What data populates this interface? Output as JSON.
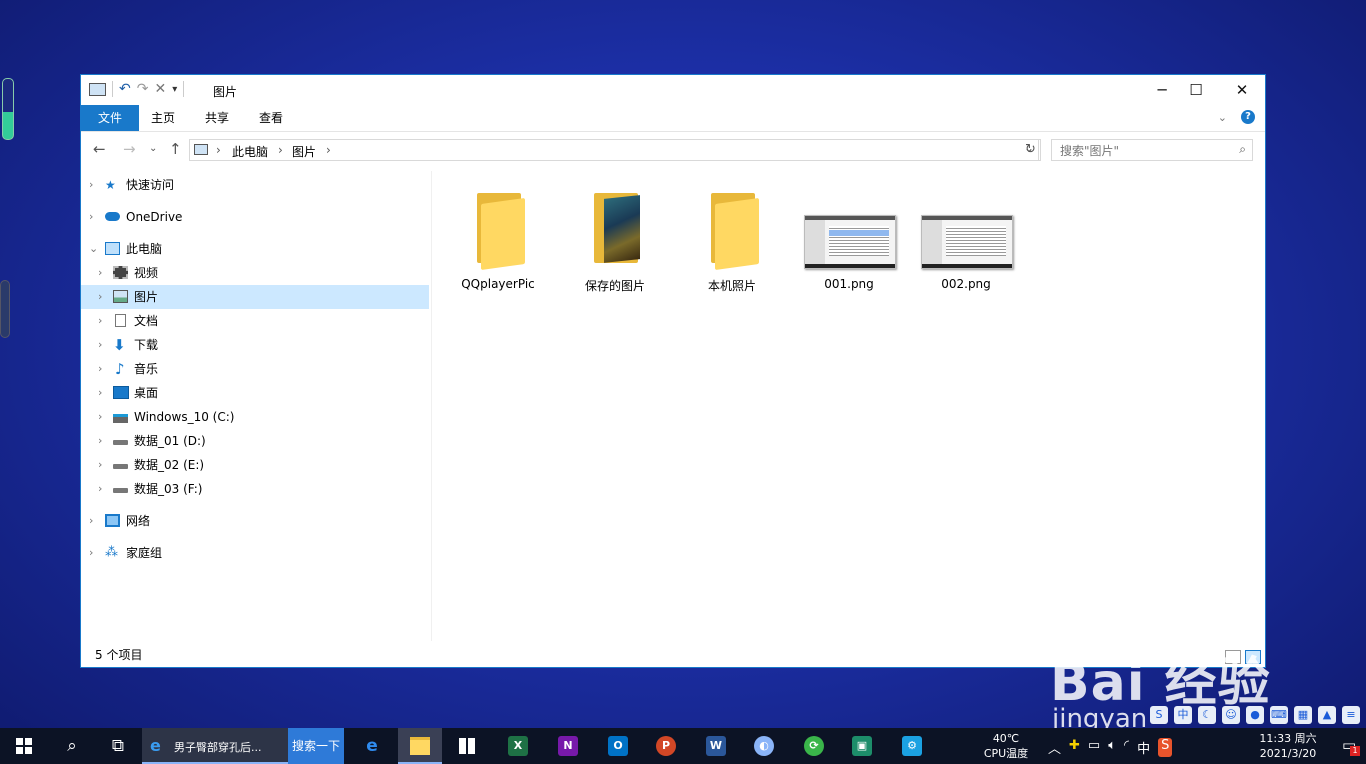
{
  "window": {
    "title": "图片",
    "controls": {
      "minimize": "─",
      "maximize": "☐",
      "close": "✕"
    }
  },
  "ribbon": {
    "tabs": [
      "文件",
      "主页",
      "共享",
      "查看"
    ],
    "expand_icon": "chevron-down-icon",
    "help": "?"
  },
  "address": {
    "crumbs": [
      "此电脑",
      "图片"
    ],
    "sep": "›",
    "search_placeholder": "搜索\"图片\""
  },
  "nav": {
    "items": [
      {
        "label": "快速访问",
        "icon": "star-icon"
      },
      {
        "label": "OneDrive",
        "icon": "cloud-icon"
      },
      {
        "label": "此电脑",
        "icon": "computer-icon"
      },
      {
        "label": "视频",
        "icon": "video-icon"
      },
      {
        "label": "图片",
        "icon": "pictures-icon"
      },
      {
        "label": "文档",
        "icon": "documents-icon"
      },
      {
        "label": "下载",
        "icon": "download-icon"
      },
      {
        "label": "音乐",
        "icon": "music-icon"
      },
      {
        "label": "桌面",
        "icon": "desktop-icon"
      },
      {
        "label": "Windows_10 (C:)",
        "icon": "drive-c-icon"
      },
      {
        "label": "数据_01 (D:)",
        "icon": "drive-icon"
      },
      {
        "label": "数据_02 (E:)",
        "icon": "drive-icon"
      },
      {
        "label": "数据_03 (F:)",
        "icon": "drive-icon"
      },
      {
        "label": "网络",
        "icon": "network-icon"
      },
      {
        "label": "家庭组",
        "icon": "homegroup-icon"
      }
    ]
  },
  "files": [
    {
      "name": "QQplayerPic",
      "type": "folder"
    },
    {
      "name": "保存的图片",
      "type": "folder-photo"
    },
    {
      "name": "本机照片",
      "type": "folder"
    },
    {
      "name": "001.png",
      "type": "image"
    },
    {
      "name": "002.png",
      "type": "image"
    }
  ],
  "status": {
    "count": "5 个项目"
  },
  "watermark": {
    "brand": "Bai 经验",
    "site": "jingyan"
  },
  "taskbar": {
    "ie_title": "男子臀部穿孔后...",
    "search_button": "搜索一下",
    "temperature": "40℃",
    "temperature_label": "CPU温度",
    "ime": "中",
    "time": "11:33 周六",
    "date": "2021/3/20",
    "notification_count": "1"
  },
  "colors": {
    "accent": "#1979ca",
    "selection": "#cce8ff",
    "folder": "#ffd862",
    "taskbar": "#0c1325"
  }
}
